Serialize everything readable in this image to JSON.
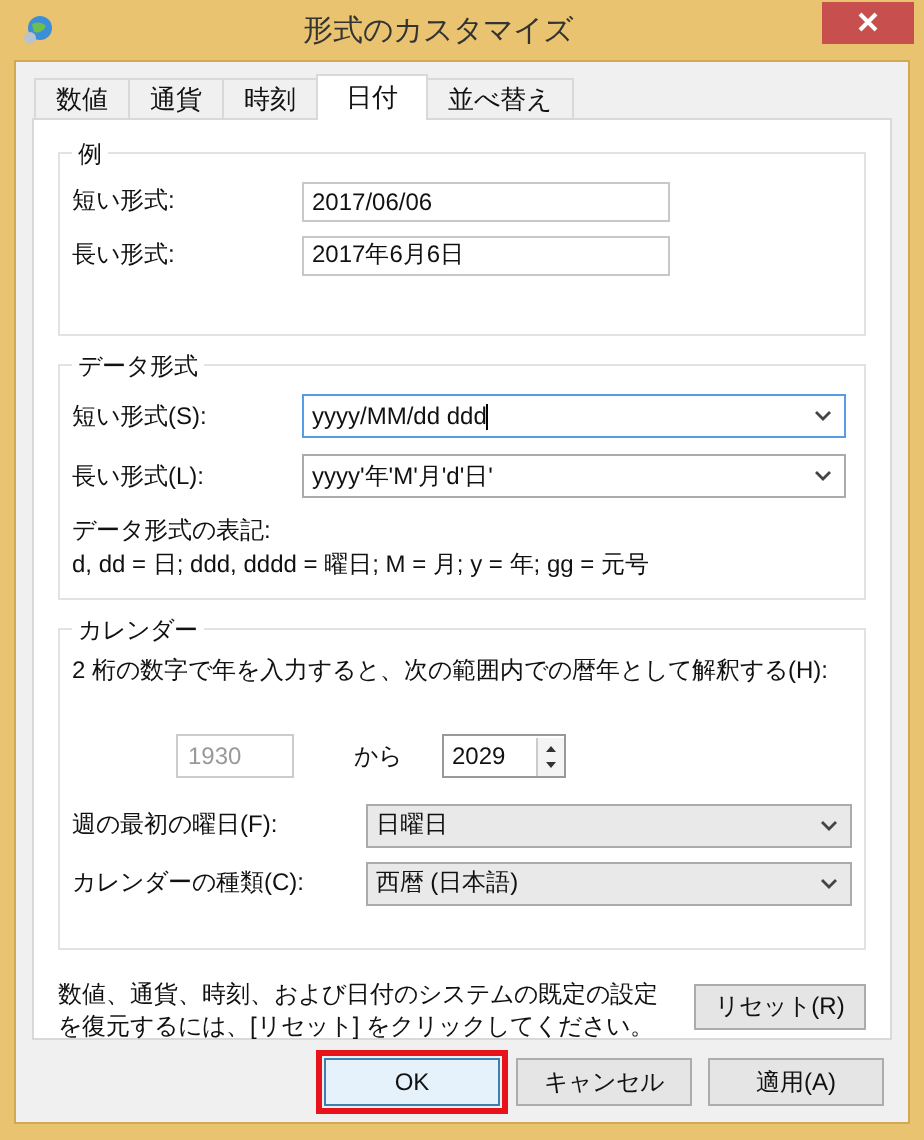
{
  "window": {
    "title": "形式のカスタマイズ"
  },
  "tabs": [
    {
      "label": "数値",
      "selected": false
    },
    {
      "label": "通貨",
      "selected": false
    },
    {
      "label": "時刻",
      "selected": false
    },
    {
      "label": "日付",
      "selected": true
    },
    {
      "label": "並べ替え",
      "selected": false
    }
  ],
  "example": {
    "title": "例",
    "rows": [
      {
        "label": "短い形式:",
        "value": "2017/06/06"
      },
      {
        "label": "長い形式:",
        "value": "2017年6月6日"
      }
    ]
  },
  "date_format": {
    "title": "データ形式",
    "rows": [
      {
        "label": "短い形式(S):",
        "value": "yyyy/MM/dd ddd",
        "focused": true
      },
      {
        "label": "長い形式(L):",
        "value": "yyyy'年'M'月'd'日'",
        "focused": false
      }
    ],
    "notation_title": "データ形式の表記:",
    "notation": "d, dd = 日;  ddd, dddd = 曜日; M = 月; y = 年; gg = 元号"
  },
  "calendar": {
    "title": "カレンダー",
    "description": "2 桁の数字で年を入力すると、次の範囲内での暦年として解釈する(H):",
    "range_from": {
      "value": "1930",
      "disabled": true
    },
    "range_word": "から",
    "range_to": {
      "value": "2029"
    },
    "rows": [
      {
        "label": "週の最初の曜日(F):",
        "value": "日曜日"
      },
      {
        "label": "カレンダーの種類(C):",
        "value": "西暦 (日本語)"
      }
    ]
  },
  "reset": {
    "text": "数値、通貨、時刻、および日付のシステムの既定の設定を復元するには、[リセット] をクリックしてください。",
    "button": "リセット(R)"
  },
  "buttons": [
    {
      "label": "OK",
      "highlighted": true
    },
    {
      "label": "キャンセル",
      "highlighted": false
    },
    {
      "label": "適用(A)",
      "highlighted": false
    }
  ]
}
